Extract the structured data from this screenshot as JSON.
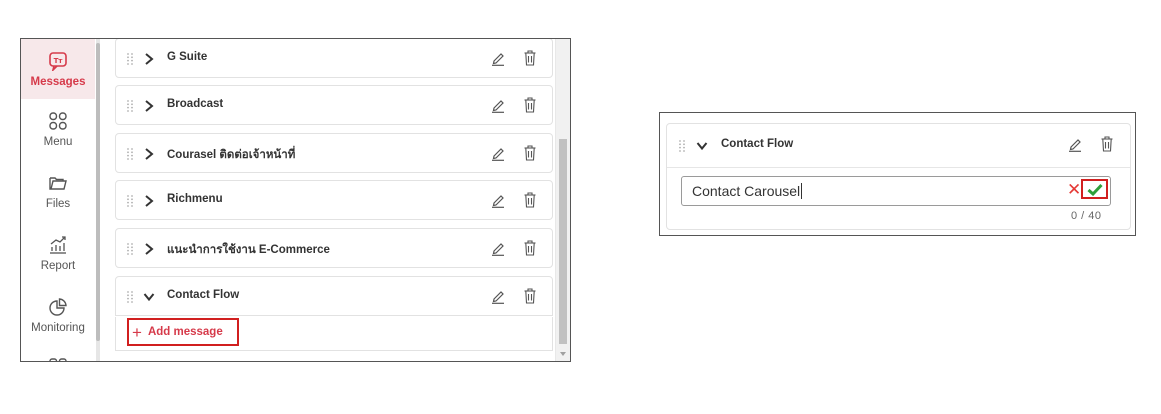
{
  "sidebar": {
    "items": [
      {
        "label": "Messages",
        "icon": "messages-icon",
        "active": true
      },
      {
        "label": "Menu",
        "icon": "menu-grid-icon"
      },
      {
        "label": "Files",
        "icon": "folder-icon"
      },
      {
        "label": "Report",
        "icon": "chart-icon"
      },
      {
        "label": "Monitoring",
        "icon": "pie-chart-icon"
      }
    ]
  },
  "message_groups": [
    {
      "title": "G Suite"
    },
    {
      "title": "Broadcast"
    },
    {
      "title": "Courasel ติดต่อเจ้าหน้าที่"
    },
    {
      "title": "Richmenu"
    },
    {
      "title": "แนะนำการใช้งาน E-Commerce"
    },
    {
      "title": "Contact Flow"
    }
  ],
  "add_message": {
    "label": "Add message"
  },
  "edit_panel": {
    "group_title": "Contact Flow",
    "input_value": "Contact Carousel",
    "counter": "0 / 40"
  },
  "colors": {
    "accent": "#d63a4a",
    "highlight_border": "#d11f1f",
    "confirm_green": "#2e9e3a",
    "cancel_red": "#e53935"
  }
}
